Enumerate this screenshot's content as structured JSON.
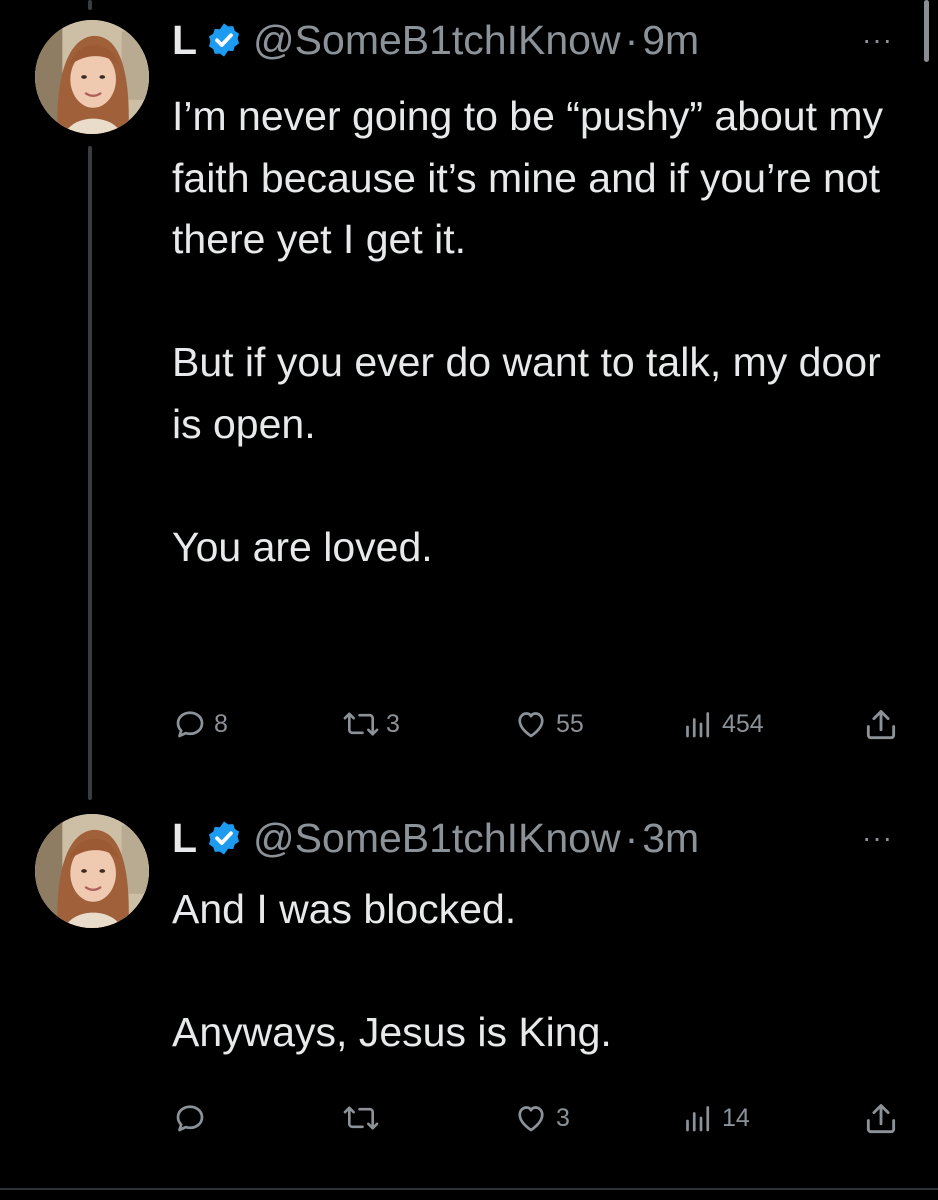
{
  "tweets": [
    {
      "display_name": "L",
      "handle": "@SomeB1tchIKnow",
      "time_sep": "·",
      "time": "9m",
      "more": "···",
      "paragraphs": [
        "I’m never going to be “pushy” about my faith because it’s mine and if you’re not there yet I get it.",
        "But if you ever do want to talk, my door is open.",
        "You are loved."
      ],
      "actions": {
        "replies": "8",
        "retweets": "3",
        "likes": "55",
        "views": "454"
      }
    },
    {
      "display_name": "L",
      "handle": "@SomeB1tchIKnow",
      "time_sep": "·",
      "time": "3m",
      "more": "···",
      "paragraphs": [
        "And I was blocked.",
        "Anyways, Jesus is King."
      ],
      "actions": {
        "replies": "",
        "retweets": "",
        "likes": "3",
        "views": "14"
      }
    }
  ],
  "icons": {
    "verified": "verified-badge-icon",
    "reply": "reply-bubble-icon",
    "retweet": "retweet-arrows-icon",
    "like": "heart-icon",
    "views": "bar-chart-icon",
    "share": "share-upload-icon"
  },
  "colors": {
    "background": "#000000",
    "text": "#e7e9ea",
    "muted": "#8b9298",
    "verified": "#1d9bf0",
    "thread_line": "#3a3d40"
  }
}
